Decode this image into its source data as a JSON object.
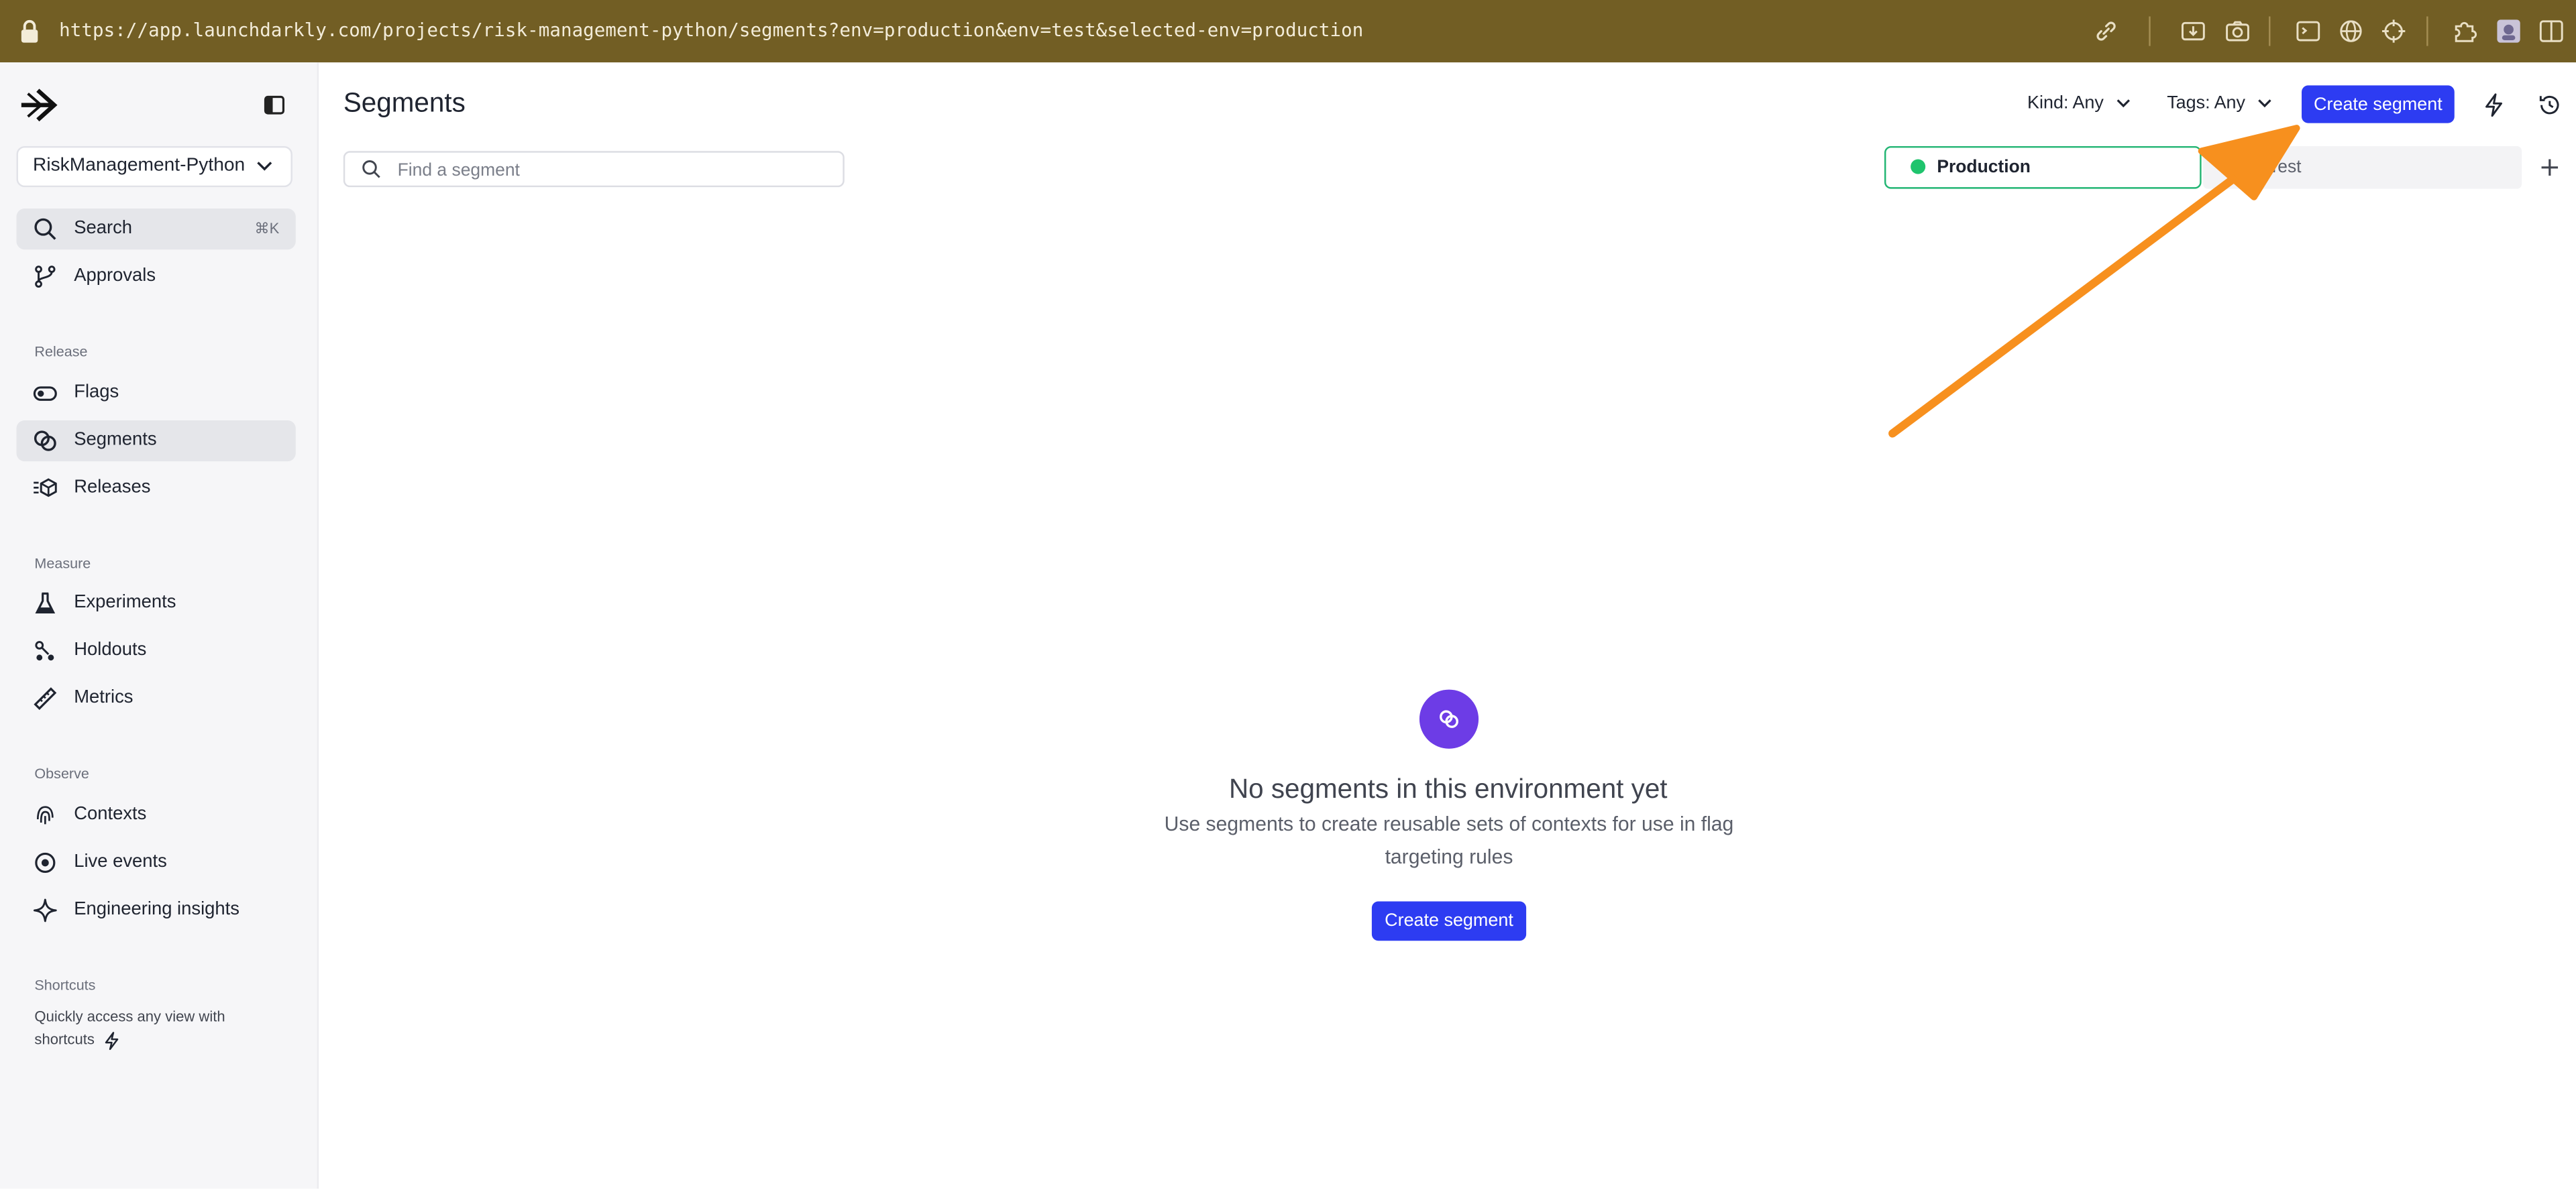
{
  "browser": {
    "url": "https://app.launchdarkly.com/projects/risk-management-python/segments?env=production&env=test&selected-env=production",
    "bar_color": "#725e24"
  },
  "sidebar": {
    "project_name": "RiskManagement-Python",
    "search": {
      "label": "Search",
      "shortcut": "⌘K"
    },
    "approvals_label": "Approvals",
    "sections": {
      "release": "Release",
      "measure": "Measure",
      "observe": "Observe",
      "shortcuts": "Shortcuts"
    },
    "items": {
      "flags": "Flags",
      "segments": "Segments",
      "releases": "Releases",
      "experiments": "Experiments",
      "holdouts": "Holdouts",
      "metrics": "Metrics",
      "contexts": "Contexts",
      "live_events": "Live events",
      "engineering_insights": "Engineering insights"
    },
    "shortcuts_text": "Quickly access any view with shortcuts"
  },
  "header": {
    "title": "Segments",
    "kind_filter": "Kind: Any",
    "tags_filter": "Tags: Any",
    "create_label": "Create segment"
  },
  "search": {
    "placeholder": "Find a segment"
  },
  "environments": {
    "production": "Production",
    "test": "Test",
    "production_color": "#1fc46d"
  },
  "empty_state": {
    "title": "No segments in this environment yet",
    "description": "Use segments to create reusable sets of contexts for use in flag targeting rules",
    "button_label": "Create segment"
  },
  "colors": {
    "primary": "#2d3cf2",
    "accent_purple": "#6d3ce6",
    "annotation_arrow": "#f7901e"
  }
}
